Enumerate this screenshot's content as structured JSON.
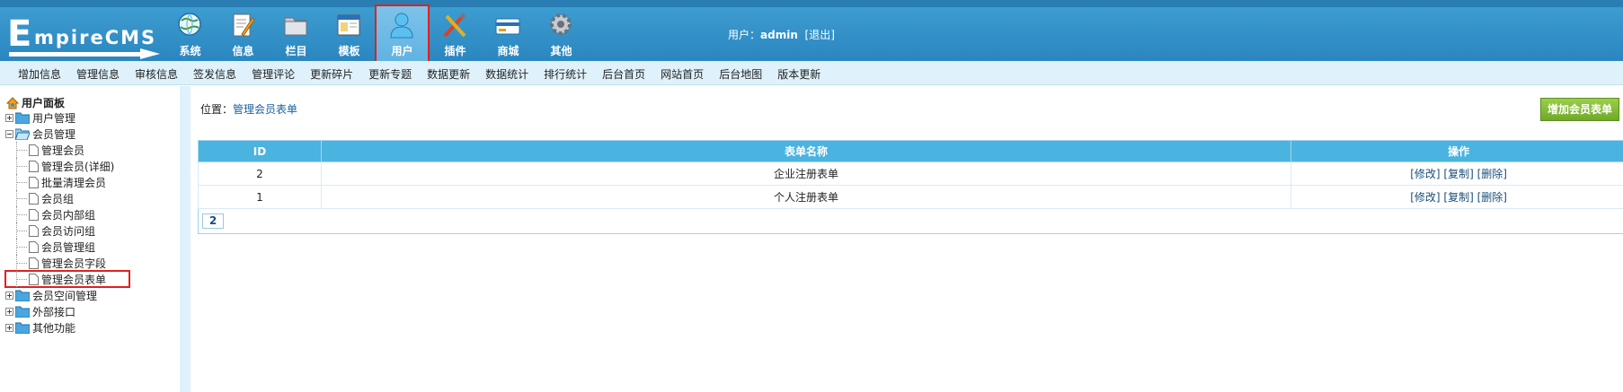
{
  "logo": {
    "initial": "E",
    "rest": "mpireCMS"
  },
  "menu": [
    {
      "label": "系统",
      "icon": "globe-icon"
    },
    {
      "label": "信息",
      "icon": "edit-document-icon"
    },
    {
      "label": "栏目",
      "icon": "folder-icon"
    },
    {
      "label": "模板",
      "icon": "window-template-icon"
    },
    {
      "label": "用户",
      "icon": "user-icon"
    },
    {
      "label": "插件",
      "icon": "tools-icon"
    },
    {
      "label": "商城",
      "icon": "shop-card-icon"
    },
    {
      "label": "其他",
      "icon": "gear-icon"
    }
  ],
  "user": {
    "prefix": "用户：",
    "name": "admin",
    "logout": "[退出]"
  },
  "subnav": [
    "增加信息",
    "管理信息",
    "审核信息",
    "签发信息",
    "管理评论",
    "更新碎片",
    "更新专题",
    "数据更新",
    "数据统计",
    "排行统计",
    "后台首页",
    "网站首页",
    "后台地图",
    "版本更新"
  ],
  "tree": {
    "title": "用户面板",
    "nodes": [
      {
        "label": "用户管理",
        "expanded": false
      },
      {
        "label": "会员管理",
        "expanded": true
      },
      {
        "label": "会员空间管理",
        "expanded": false
      },
      {
        "label": "外部接口",
        "expanded": false
      },
      {
        "label": "其他功能",
        "expanded": false
      }
    ],
    "member_children": [
      "管理会员",
      "管理会员(详细)",
      "批量清理会员",
      "会员组",
      "会员内部组",
      "会员访问组",
      "会员管理组",
      "管理会员字段",
      "管理会员表单"
    ]
  },
  "main": {
    "location_label": "位置：",
    "location_link": "管理会员表单",
    "add_button": "增加会员表单",
    "table": {
      "headers": [
        "ID",
        "表单名称",
        "操作"
      ],
      "rows": [
        {
          "id": "2",
          "name": "企业注册表单",
          "ops": [
            "[修改]",
            "[复制]",
            "[删除]"
          ]
        },
        {
          "id": "1",
          "name": "个人注册表单",
          "ops": [
            "[修改]",
            "[复制]",
            "[删除]"
          ]
        }
      ]
    },
    "page": "2"
  },
  "colors": {
    "banner": "#3a98cf",
    "subnav": "#dff1fb",
    "table_header": "#4ab3df",
    "add_button": "#7fba33",
    "highlight": "#e02020"
  }
}
